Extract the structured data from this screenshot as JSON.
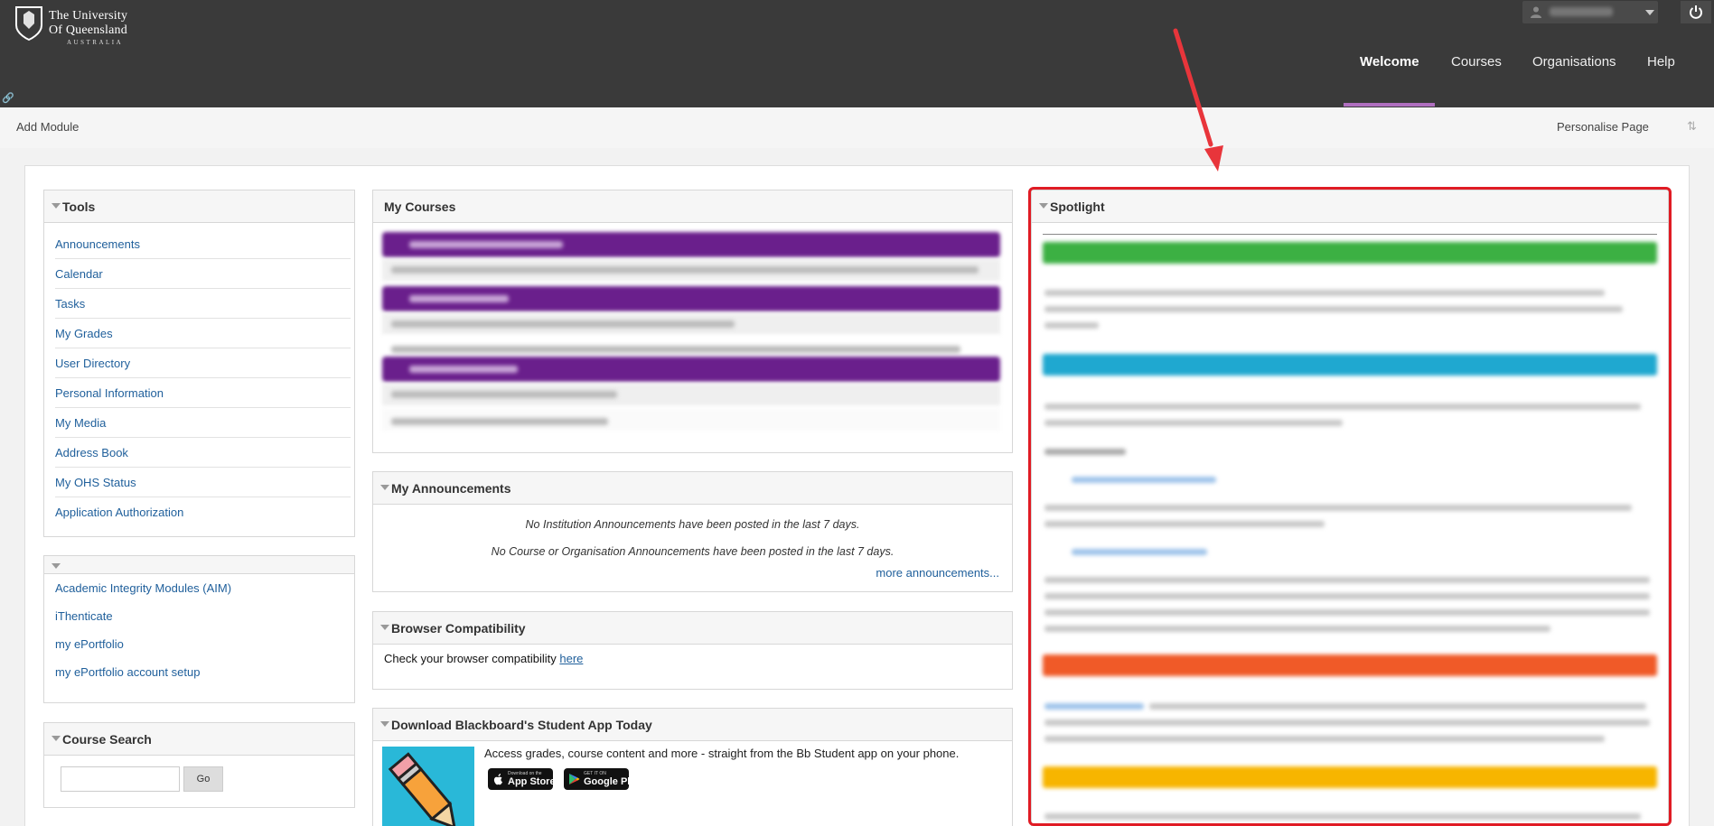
{
  "header": {
    "logo": {
      "line1": "The University",
      "line2": "Of Queensland",
      "line3": "AUSTRALIA"
    },
    "nav": [
      {
        "label": "Welcome",
        "active": true
      },
      {
        "label": "Courses"
      },
      {
        "label": "Organisations"
      },
      {
        "label": "Help"
      }
    ],
    "accent_color": "#b06fc0"
  },
  "subbar": {
    "add_module": "Add Module",
    "personalise": "Personalise Page"
  },
  "tools": {
    "title": "Tools",
    "items": [
      "Announcements",
      "Calendar",
      "Tasks",
      "My Grades",
      "User Directory",
      "Personal Information",
      "My Media",
      "Address Book",
      "My OHS Status",
      "Application Authorization"
    ]
  },
  "links_module": {
    "items": [
      "Academic Integrity Modules (AIM)",
      "iThenticate",
      "my ePortfolio",
      "my ePortfolio account setup"
    ]
  },
  "course_search": {
    "title": "Course Search",
    "go_label": "Go"
  },
  "my_courses": {
    "title": "My Courses",
    "group_color": "#6a1f8c"
  },
  "announcements": {
    "title": "My Announcements",
    "institution_msg": "No Institution Announcements have been posted in the last 7 days.",
    "course_msg": "No Course or Organisation Announcements have been posted in the last 7 days.",
    "more": "more announcements..."
  },
  "browser": {
    "title": "Browser Compatibility",
    "text": "Check your browser compatibility ",
    "link": "here"
  },
  "app": {
    "title": "Download Blackboard's Student App Today",
    "text": "Access grades, course content and more - straight from the Bb Student app on your phone.",
    "app_store_small": "Download on the",
    "app_store": "App Store",
    "google_small": "GET IT ON",
    "google": "Google Play"
  },
  "spotlight": {
    "title": "Spotlight",
    "bar_colors": [
      "#3cb043",
      "#1fa8d0",
      "#f05a28",
      "#f7b500"
    ],
    "outline_color": "#e01b24"
  }
}
